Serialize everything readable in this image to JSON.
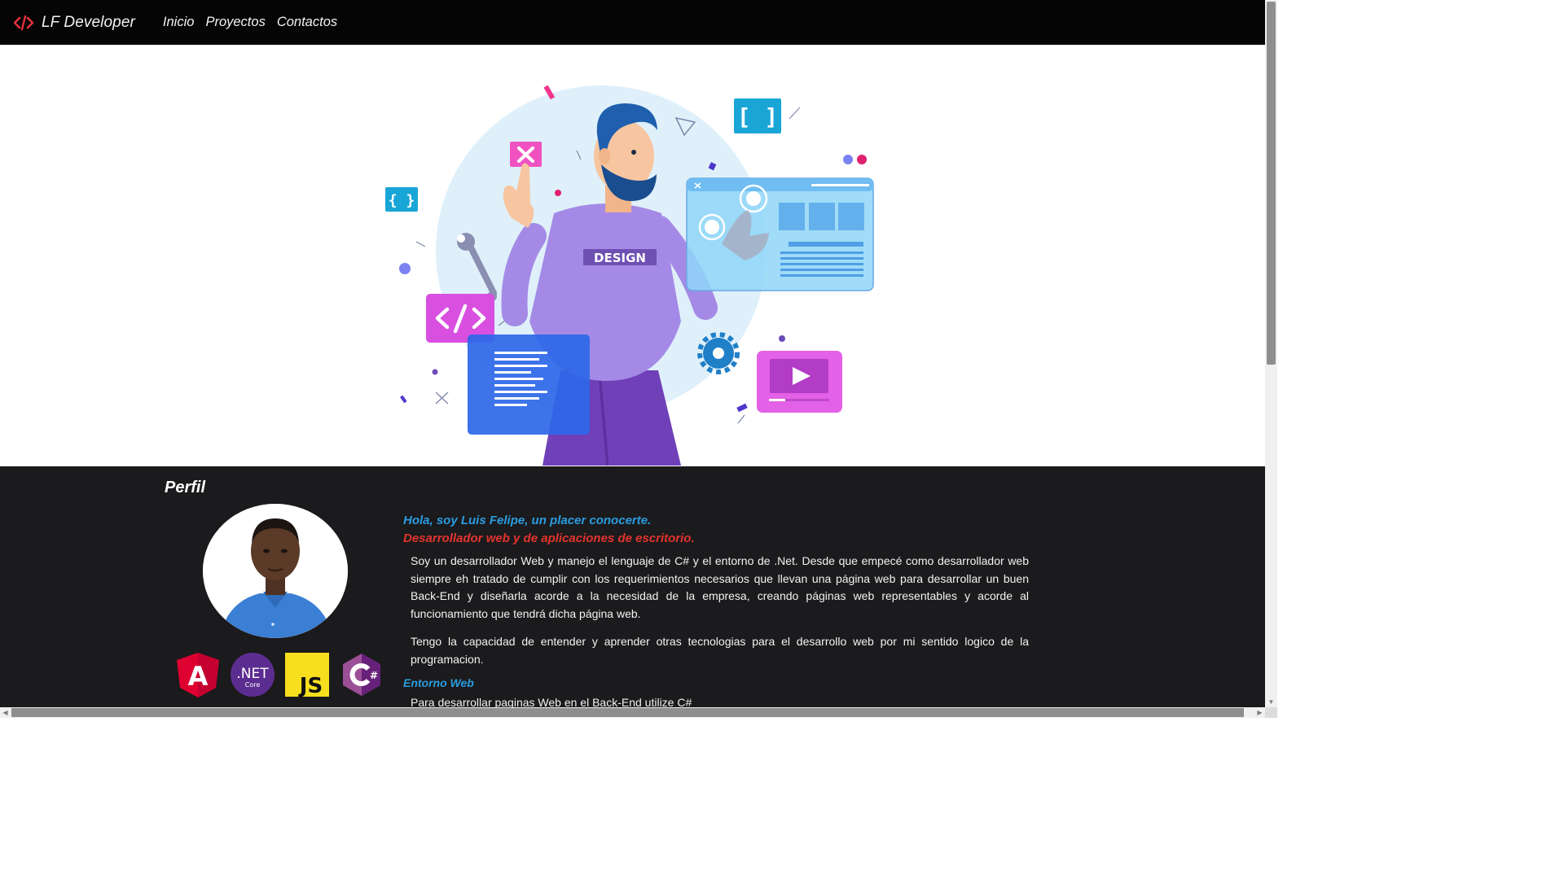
{
  "navbar": {
    "brand": "LF Developer",
    "links": [
      "Inicio",
      "Proyectos",
      "Contactos"
    ],
    "brand_icon": "code-icon",
    "brand_icon_color": "#e8303b"
  },
  "hero": {
    "illustration": "developer-design-illustration",
    "shirt_text": "DESIGN"
  },
  "profile": {
    "title": "Perfil",
    "greeting": "Hola, soy Luis Felipe, un placer conocerte.",
    "role": "Desarrollador web y de aplicaciones de escritorio.",
    "paragraphs": [
      "Soy un desarrollador Web y manejo el lenguaje de C# y el entorno de .Net. Desde que empecé como desarrollador web siempre eh tratado de cumplir con los requerimientos necesarios que llevan una página web para desarrollar un buen Back-End y diseñarla acorde a la necesidad de la empresa, creando páginas web representables y acorde al funcionamiento que tendrá dicha página web.",
      "Tengo la capacidad de entender y aprender otras tecnologias para el desarrollo web por mi sentido logico de la programacion."
    ],
    "subheading": "Entorno Web",
    "cut_line": "Para desarrollar paginas Web en el Back-End utilize C#",
    "tech_logos": [
      {
        "name": "angular-logo",
        "label": "A"
      },
      {
        "name": "dotnet-core-logo",
        "label": ".NET",
        "sublabel": "Core"
      },
      {
        "name": "javascript-logo",
        "label": "JS"
      },
      {
        "name": "csharp-logo",
        "label": "C#"
      }
    ]
  },
  "colors": {
    "navbar_bg": "#050505",
    "profile_bg": "#1b1a1c",
    "accent_blue": "#2a9de0",
    "accent_red": "#e3342f"
  }
}
